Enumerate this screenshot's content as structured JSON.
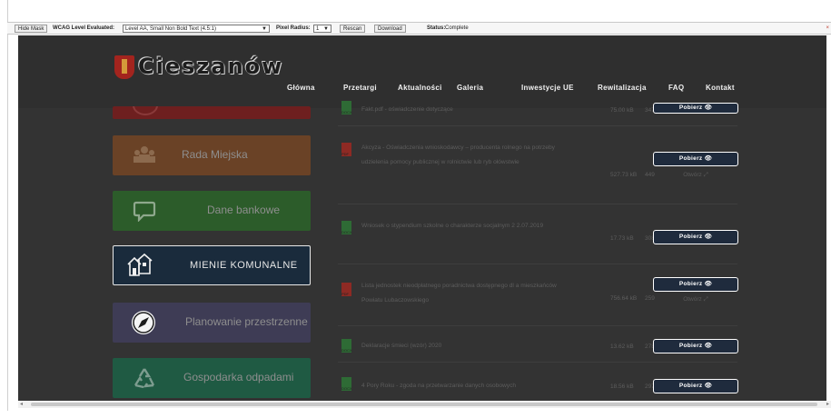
{
  "toolbar": {
    "hide_mask": "Hide Mask",
    "wcag_label": "WCAG Level Evaluated:",
    "wcag_value": "Level AA, Small Non Bold Text (4.5:1)",
    "pixel_radius_label": "Pixel Radius:",
    "pixel_radius_value": "1",
    "rescan": "Rescan",
    "download": "Download",
    "status_label": "Status:",
    "status_value": "Complete"
  },
  "site": {
    "logo_text": "Cieszanów",
    "nav": [
      "Główna",
      "Przetargi",
      "Aktualności",
      "Galeria",
      "Inwestycje UE",
      "Rewitalizacja",
      "FAQ",
      "Kontakt"
    ]
  },
  "tiles": [
    {
      "label": "",
      "icon": "partial-tile-icon",
      "color": "#6e1f1f"
    },
    {
      "label": "Rada Miejska",
      "icon": "people-icon",
      "color": "#6a4226"
    },
    {
      "label": "Dane bankowe",
      "icon": "chat-bubble-icon",
      "color": "#2c5c2a"
    },
    {
      "label": "MIENIE KOMUNALNE",
      "icon": "houses-icon",
      "color": "#1a2b3c"
    },
    {
      "label": "Planowanie przestrzenne",
      "icon": "compass-icon",
      "color": "#3e3c55"
    },
    {
      "label": "Gospodarka odpadami",
      "icon": "recycle-icon",
      "color": "#1f5a43"
    }
  ],
  "documents": [
    {
      "title": "Fakt.pdf - oświadczenie dotyczące",
      "type": "pdf",
      "size": "75.00 kB",
      "downloads": "347",
      "download_label": "Pobierz",
      "preview_label": ""
    },
    {
      "title": "Akcyza - Oświadczenia wnioskodawcy – producenta rolnego na potrzeby udzielenia pomocy publicznej w rolnictwie lub ryb ołówstwie",
      "type": "pdf",
      "size": "527.73 kB",
      "downloads": "449",
      "download_label": "Pobierz",
      "preview_label": "Otwórz"
    },
    {
      "title": "Wniosek o stypendium szkolne o charakterze socjalnym 2 2.07.2019",
      "type": "doc",
      "size": "17.73 kB",
      "downloads": "308",
      "download_label": "Pobierz",
      "preview_label": ""
    },
    {
      "title": "Lista jednostek nieodpłatnego poradnictwa dostępnego dl a mieszkańców Powiatu Lubaczowskiego",
      "type": "pdf",
      "size": "756.64 kB",
      "downloads": "259",
      "download_label": "Pobierz",
      "preview_label": "Otwórz"
    },
    {
      "title": "Deklaracje śmieci (wzór) 2020",
      "type": "doc",
      "size": "13.62 kB",
      "downloads": "278",
      "download_label": "Pobierz",
      "preview_label": ""
    },
    {
      "title": "4 Pory Roku - zgoda na przetwarzanie danych osobowych",
      "type": "doc",
      "size": "18.56 kB",
      "downloads": "297",
      "download_label": "Pobierz",
      "preview_label": ""
    }
  ],
  "colors": {
    "overlay_bg": "#333333",
    "pdf_red": "#8e2a24",
    "doc_green": "#2e6b35",
    "button_bg": "#1f2b3d"
  }
}
